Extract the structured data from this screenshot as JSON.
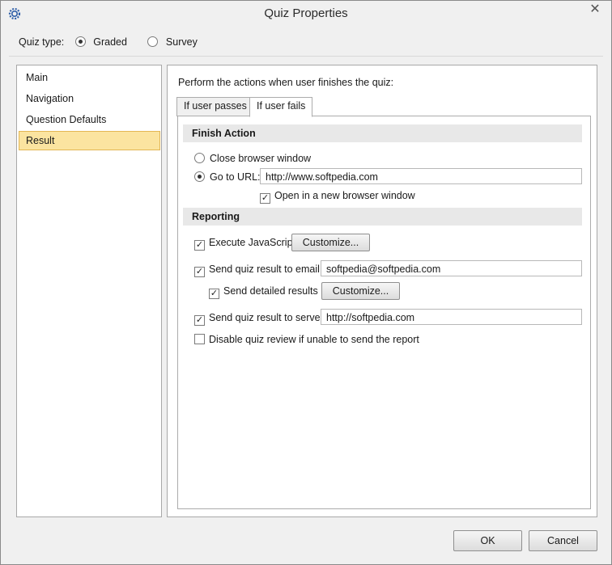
{
  "window": {
    "title": "Quiz Properties",
    "close_glyph": "✕"
  },
  "quiz_type": {
    "label": "Quiz type:",
    "options": [
      "Graded",
      "Survey"
    ],
    "selected": "Graded"
  },
  "nav": {
    "items": [
      "Main",
      "Navigation",
      "Question Defaults",
      "Result"
    ],
    "selected": "Result"
  },
  "content": {
    "intro": "Perform the actions when user finishes the quiz:",
    "tabs": [
      "If user passes",
      "If user fails"
    ],
    "active_tab": "If user fails",
    "finish_action": {
      "header": "Finish Action",
      "close_browser": "Close browser window",
      "goto_url": "Go to URL:",
      "url_value": "http://www.softpedia.com",
      "open_new_window": "Open in a new browser window",
      "selected": "Go to URL:",
      "open_new_window_checked": true
    },
    "reporting": {
      "header": "Reporting",
      "exec_js": "Execute JavaScript",
      "exec_js_checked": true,
      "customize1": "Customize...",
      "send_email": "Send quiz result to email",
      "send_email_checked": true,
      "email_value": "softpedia@softpedia.com",
      "send_detailed": "Send detailed results",
      "send_detailed_checked": true,
      "customize2": "Customize...",
      "send_server": "Send quiz result to server",
      "send_server_checked": true,
      "server_value": "http://softpedia.com",
      "disable_review": "Disable quiz review if unable to send the report",
      "disable_review_checked": false
    }
  },
  "buttons": {
    "ok": "OK",
    "cancel": "Cancel"
  },
  "colors": {
    "selection_bg": "#fbe4a0",
    "selection_border": "#e3b653",
    "section_bg": "#e8e8e8"
  }
}
